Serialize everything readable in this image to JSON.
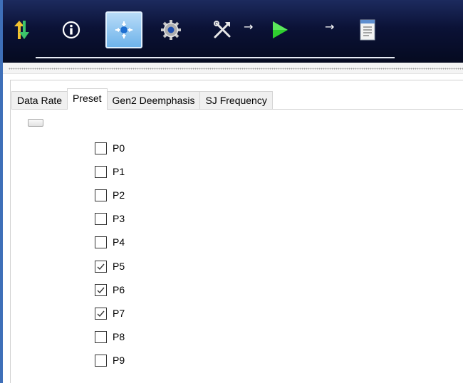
{
  "toolbar": {
    "buttons": [
      {
        "name": "transfer-arrows-icon"
      },
      {
        "name": "info-icon"
      },
      {
        "name": "crosshair-icon"
      },
      {
        "name": "gear-icon"
      },
      {
        "name": "tools-icon"
      },
      {
        "name": "play-icon"
      },
      {
        "name": "report-icon"
      }
    ],
    "arrow": "→"
  },
  "tabs": [
    "Data Rate",
    "Preset",
    "Gen2 Deemphasis",
    "SJ Frequency"
  ],
  "active_tab": "Preset",
  "presets": [
    {
      "label": "P0",
      "checked": false
    },
    {
      "label": "P1",
      "checked": false
    },
    {
      "label": "P2",
      "checked": false
    },
    {
      "label": "P3",
      "checked": false
    },
    {
      "label": "P4",
      "checked": false
    },
    {
      "label": "P5",
      "checked": true
    },
    {
      "label": "P6",
      "checked": true
    },
    {
      "label": "P7",
      "checked": true
    },
    {
      "label": "P8",
      "checked": false
    },
    {
      "label": "P9",
      "checked": false
    }
  ],
  "colors": {
    "toolbar_bg": "#0b1236",
    "active_button": "#6eb3ea",
    "play_green": "#2fcf2f"
  }
}
